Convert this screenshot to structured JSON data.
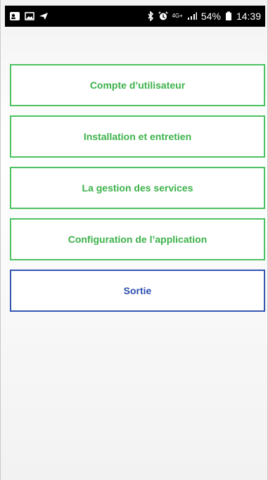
{
  "status_bar": {
    "signal_label": "4G+",
    "battery": "54%",
    "time": "14:39",
    "icons": [
      "contact-card-icon",
      "gallery-icon",
      "send-icon",
      "bluetooth-icon",
      "alarm-icon",
      "signal-bars-icon",
      "battery-icon"
    ]
  },
  "menu": {
    "items": [
      {
        "label": "Compte d’utilisateur"
      },
      {
        "label": "Installation et entretien"
      },
      {
        "label": "La gestion des services"
      },
      {
        "label": "Configuration de l’application"
      },
      {
        "label": "Sortie"
      }
    ]
  },
  "colors": {
    "green": "#3cb24a",
    "blue": "#2f4fb0",
    "status_bg": "#000000"
  }
}
